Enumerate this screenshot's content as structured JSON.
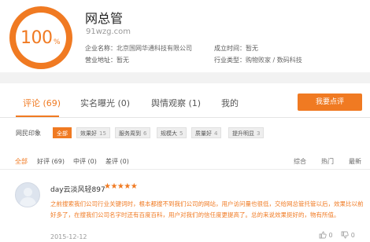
{
  "site": {
    "score": "100",
    "score_unit": "%",
    "name": "网总管",
    "domain": "91wzg.com"
  },
  "info": {
    "company_label": "企业名称：",
    "company_value": "北京国网华通科技有限公司",
    "established_label": "成立时间：",
    "established_value": "暂无",
    "address_label": "营业地址：",
    "address_value": "暂无",
    "industry_label": "行业类型：",
    "industry_value": "购物败家 / 数码科技"
  },
  "tabs": [
    {
      "label": "评论 (69)"
    },
    {
      "label": "实名曝光 (0)"
    },
    {
      "label": "舆情观察 (1)"
    },
    {
      "label": "我的"
    }
  ],
  "review_button": "我要点评",
  "impression": {
    "label": "网民印象",
    "chips": [
      {
        "label": "全部",
        "count": ""
      },
      {
        "label": "效果好",
        "count": "15"
      },
      {
        "label": "服务周到",
        "count": "6"
      },
      {
        "label": "规模大",
        "count": "5"
      },
      {
        "label": "质量好",
        "count": "4"
      },
      {
        "label": "提升明显",
        "count": "3"
      }
    ]
  },
  "filters": [
    {
      "label": "全部"
    },
    {
      "label": "好评 (69)"
    },
    {
      "label": "中评 (0)"
    },
    {
      "label": "差评 (0)"
    }
  ],
  "sort": {
    "overall": "综合",
    "hot": "热门",
    "latest": "最新"
  },
  "review": {
    "user": "day云淡风轻897",
    "stars": "★★★★★",
    "rating": 5,
    "text": "之前搜索我们公司行业关键词时，根本都搜不到我们公司的网站，用户访问量也很低，交给网总管托管以后，效果比以前好多了，在搜我们公司名字时还有百度百科，用户对我们的信任度更提高了。总的来说效果挺好的，物有所值。",
    "date": "2015-12-12",
    "likes": "0",
    "dislikes": "0"
  },
  "colors": {
    "accent": "#f07a22"
  }
}
